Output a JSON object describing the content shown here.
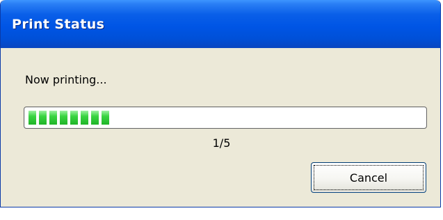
{
  "window": {
    "title": "Print Status"
  },
  "dialog": {
    "message": "Now printing...",
    "progress": {
      "fraction": 0.2,
      "page_count_text": "1/5"
    },
    "cancel_label": "Cancel"
  },
  "colors": {
    "titlebar": "#0055e5",
    "dialog_background": "#ece9d8",
    "progress_fill": "#36c83e"
  }
}
